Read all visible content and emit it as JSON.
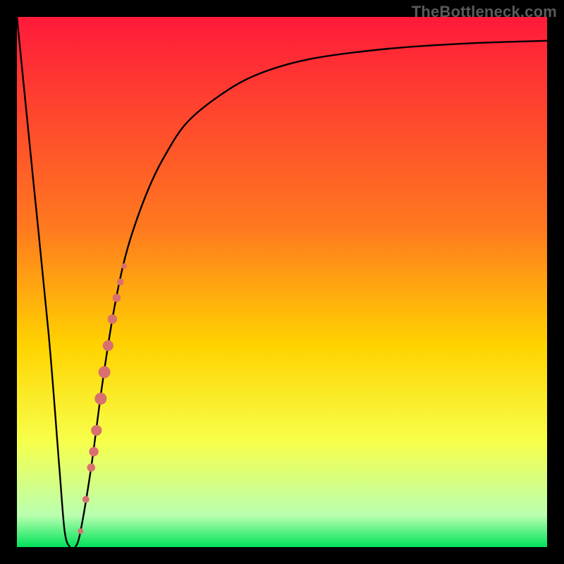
{
  "watermark": "TheBottleneck.com",
  "chart_data": {
    "type": "line",
    "title": "",
    "xlabel": "",
    "ylabel": "",
    "xlim": [
      0,
      100
    ],
    "ylim": [
      0,
      100
    ],
    "background_gradient": {
      "stops": [
        {
          "y": 100,
          "color": "#ff1a3a"
        },
        {
          "y": 60,
          "color": "#ff7a1f"
        },
        {
          "y": 38,
          "color": "#ffd300"
        },
        {
          "y": 20,
          "color": "#f7ff4a"
        },
        {
          "y": 6,
          "color": "#baffb0"
        },
        {
          "y": 0,
          "color": "#00e35a"
        }
      ]
    },
    "series": [
      {
        "name": "bottleneck-curve",
        "x": [
          0,
          3,
          6,
          8,
          9,
          10,
          11,
          12,
          14,
          16,
          18,
          20,
          22,
          25,
          28,
          32,
          38,
          45,
          55,
          70,
          85,
          100
        ],
        "y": [
          100,
          70,
          40,
          15,
          3,
          0,
          0,
          3,
          15,
          30,
          43,
          53,
          60,
          68,
          74,
          80,
          85,
          89,
          92,
          94,
          95,
          95.5
        ]
      }
    ],
    "highlight_points": {
      "name": "highlight-segment",
      "color": "#d9706f",
      "points": [
        {
          "x": 12.0,
          "y": 3
        },
        {
          "x": 13.0,
          "y": 9
        },
        {
          "x": 14.0,
          "y": 15
        },
        {
          "x": 14.5,
          "y": 18
        },
        {
          "x": 15.0,
          "y": 22
        },
        {
          "x": 15.8,
          "y": 28
        },
        {
          "x": 16.5,
          "y": 33
        },
        {
          "x": 17.2,
          "y": 38
        },
        {
          "x": 18.0,
          "y": 43
        },
        {
          "x": 18.8,
          "y": 47
        },
        {
          "x": 19.5,
          "y": 50
        },
        {
          "x": 20.2,
          "y": 53
        }
      ]
    }
  }
}
